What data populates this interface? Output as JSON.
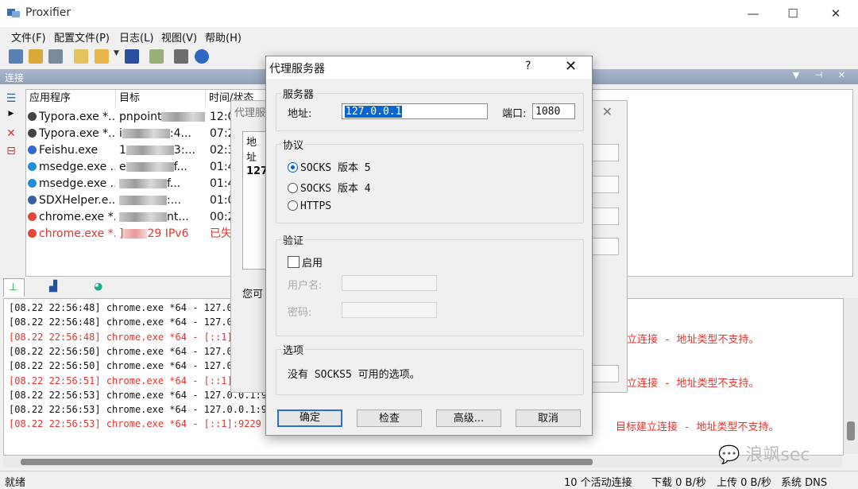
{
  "window": {
    "title": "Proxifier"
  },
  "menu": [
    "文件(F)",
    "配置文件(P)",
    "日志(L)",
    "视图(V)",
    "帮助(H)"
  ],
  "panel": {
    "title": "连接"
  },
  "table": {
    "headers": [
      "应用程序",
      "目标",
      "时间/状态"
    ],
    "rows": [
      {
        "app": "Typora.exe *...",
        "target": "pnpoint",
        "target_tail": "w...",
        "time": "12:0",
        "err": false
      },
      {
        "app": "Typora.exe *...",
        "target": "i",
        "target_tail": ":4...",
        "time": "07:2",
        "err": false
      },
      {
        "app": "Feishu.exe",
        "target": "1",
        "target_tail": "3:...",
        "time": "02:3",
        "err": false
      },
      {
        "app": "msedge.exe ...",
        "target": "e",
        "target_tail": "f...",
        "time": "01:4",
        "err": false
      },
      {
        "app": "msedge.exe ...",
        "target": "",
        "target_tail": "f...",
        "time": "01:4",
        "err": false
      },
      {
        "app": "SDXHelper.e...",
        "target": "",
        "target_tail": ":...",
        "time": "01:0",
        "err": false
      },
      {
        "app": "chrome.exe *...",
        "target": "",
        "target_tail": "nt...",
        "time": "00:2",
        "err": false
      },
      {
        "app": "chrome.exe *...",
        "target": "]",
        "target_tail": "29 IPv6",
        "time": "已失",
        "err": true
      }
    ]
  },
  "tabs": [
    "连接",
    "流量",
    "统计"
  ],
  "log": [
    {
      "text": "[08.22 22:56:48] chrome.exe *64 - 127.0.0",
      "err": false
    },
    {
      "text": "[08.22 22:56:48] chrome.exe *64 - 127.0.0",
      "err": false
    },
    {
      "text": "[08.22 22:56:48] chrome.exe *64 - [::1]:9",
      "err": true
    },
    {
      "text": "[08.22 22:56:50] chrome.exe *64 - 127.0.0",
      "err": false
    },
    {
      "text": "[08.22 22:56:50] chrome.exe *64 - 127.0.0",
      "err": false
    },
    {
      "text": "[08.22 22:56:51] chrome.exe *64 - [::1]:9",
      "err": true
    },
    {
      "text": "[08.22 22:56:53] chrome.exe *64 - 127.0.0.1:9229",
      "err": false
    },
    {
      "text": "[08.22 22:56:53] chrome.exe *64 - 127.0.0.1:9229",
      "err": false
    },
    {
      "text": "[08.22 22:56:53] chrome.exe *64 - [::1]:9229 (IP",
      "err": true
    }
  ],
  "log_right": [
    "立连接 - 地址类型不支持。",
    "立连接 - 地址类型不支持。",
    "目标建立连接 - 地址类型不支持。"
  ],
  "status": {
    "ready": "就绪",
    "active": "10 个活动连接",
    "down": "下载 0 B/秒",
    "up": "上传 0 B/秒",
    "dns": "系统 DNS"
  },
  "bg_dialog": {
    "title": "代理服",
    "list_header": "地址",
    "list_item": "127.",
    "note": "您可"
  },
  "dialog": {
    "title": "代理服务器",
    "help": "?",
    "close": "✕",
    "server_group": "服务器",
    "address_label": "地址:",
    "address_value": "127.0.0.1",
    "port_label": "端口:",
    "port_value": "1080",
    "protocol_group": "协议",
    "protocols": [
      "SOCKS 版本 5",
      "SOCKS 版本 4",
      "HTTPS"
    ],
    "selected_protocol": 0,
    "auth_group": "验证",
    "enable_label": "启用",
    "username_label": "用户名:",
    "password_label": "密码:",
    "options_group": "选项",
    "options_text": "没有 SOCKS5 可用的选项。",
    "buttons": {
      "ok": "确定",
      "check": "检查",
      "advanced": "高级...",
      "cancel": "取消"
    }
  },
  "watermark": "浪飒sec",
  "colors": {
    "error": "#e8332c",
    "accent": "#0a58c8",
    "header": "#8fa0b8"
  }
}
